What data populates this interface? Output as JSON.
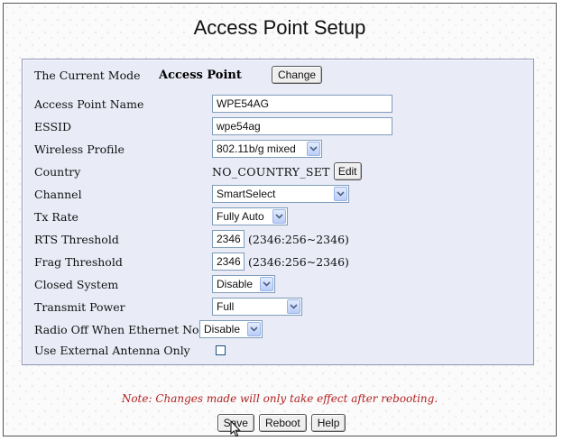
{
  "page": {
    "title": "Access Point Setup"
  },
  "form": {
    "mode": {
      "label": "The Current Mode",
      "value": "Access Point",
      "button": "Change"
    },
    "ap_name": {
      "label": "Access Point Name",
      "value": "WPE54AG"
    },
    "essid": {
      "label": "ESSID",
      "value": "wpe54ag"
    },
    "wireless_profile": {
      "label": "Wireless Profile",
      "value": "802.11b/g mixed"
    },
    "country": {
      "label": "Country",
      "value": "NO_COUNTRY_SET",
      "button": "Edit"
    },
    "channel": {
      "label": "Channel",
      "value": "SmartSelect"
    },
    "tx_rate": {
      "label": "Tx Rate",
      "value": "Fully Auto"
    },
    "rts": {
      "label": "RTS Threshold",
      "value": "2346",
      "range": "(2346:256~2346)"
    },
    "frag": {
      "label": "Frag Threshold",
      "value": "2346",
      "range": "(2346:256~2346)"
    },
    "closed_system": {
      "label": "Closed System",
      "value": "Disable"
    },
    "transmit_power": {
      "label": "Transmit Power",
      "value": "Full"
    },
    "radio_off": {
      "label": "Radio Off When Ethernet No Link",
      "value": "Disable"
    },
    "external_antenna": {
      "label": "Use External Antenna Only",
      "checked": false
    }
  },
  "note": "Note: Changes made will only take effect after rebooting.",
  "buttons": {
    "save": "Save",
    "reboot": "Reboot",
    "help": "Help"
  }
}
